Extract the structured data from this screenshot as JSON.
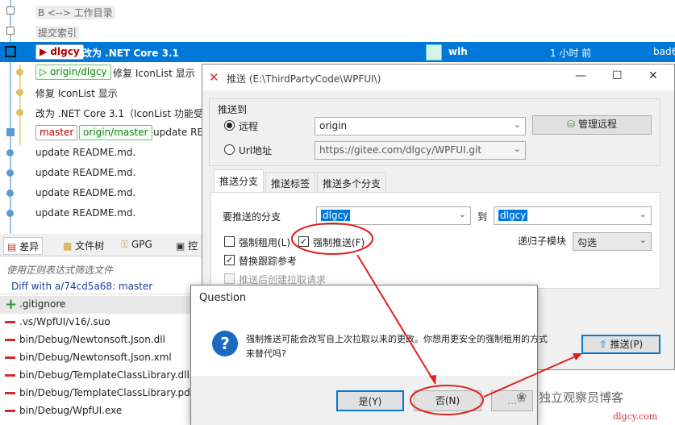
{
  "history": {
    "workdir_row": "B <--> 工作目录",
    "index_row": "提交索引",
    "selected": {
      "branch_tag": "dlgcy",
      "message": "改为 .NET Core 3.1",
      "author": "wlh",
      "time": "1 小时 前",
      "hash": "bad6"
    },
    "rows": [
      {
        "tag": "origin/dlgcy",
        "message": "修复 IconList 显示"
      },
      {
        "message": "修复 IconList 显示"
      },
      {
        "message": "改为 .NET Core 3.1（IconList 功能受"
      },
      {
        "tags": [
          "master",
          "origin/master"
        ],
        "message": "update RE"
      },
      {
        "message": "update README.md."
      },
      {
        "message": "update README.md."
      },
      {
        "message": "update README.md."
      },
      {
        "message": "update README.md."
      }
    ]
  },
  "bottom": {
    "tabs": [
      "差异",
      "文件树",
      "GPG",
      "控"
    ],
    "filter_placeholder": "使用正则表达式筛选文件",
    "diff_header": "Diff with a/74cd5a68: master",
    "files": [
      {
        "kind": "added",
        "path": ".gitignore"
      },
      {
        "kind": "removed",
        "path": ".vs/WpfUI/v16/.suo"
      },
      {
        "kind": "removed",
        "path": "bin/Debug/Newtonsoft.Json.dll"
      },
      {
        "kind": "removed",
        "path": "bin/Debug/Newtonsoft.Json.xml"
      },
      {
        "kind": "removed",
        "path": "bin/Debug/TemplateClassLibrary.dll"
      },
      {
        "kind": "removed",
        "path": "bin/Debug/TemplateClassLibrary.pdb"
      },
      {
        "kind": "removed",
        "path": "bin/Debug/WpfUI.exe"
      }
    ]
  },
  "push_dialog": {
    "title": "推送 (E:\\ThirdPartyCode\\WPFUI\\)",
    "group_label": "推送到",
    "remote_label": "远程",
    "remote_value": "origin",
    "manage_remote": "管理远程",
    "url_label": "Url地址",
    "url_value": "https://gitee.com/dlgcy/WPFUI.git",
    "tabs": [
      "推送分支",
      "推送标签",
      "推送多个分支"
    ],
    "branch_label": "要推送的分支",
    "branch_value": "dlgcy",
    "to_label": "到",
    "to_value": "dlgcy",
    "force_with_lease": "强制租用(L)",
    "force_push": "强制推送(F)",
    "recurse_label": "递归子模块",
    "recurse_value": "勾选",
    "replace_tracking": "替换跟踪参考",
    "create_pr": "推送后创建拉取请求",
    "push_button": "推送(P)"
  },
  "question_dialog": {
    "title": "Question",
    "message_line1": "强制推送可能会改写自上次拉取以来的更改。你想用更安全的强制租用的方式",
    "message_line2": "来替代吗?",
    "yes": "是(Y)",
    "no": "否(N)",
    "cancel": "取消"
  },
  "watermark": {
    "brand": "独立观察员博客",
    "url": "dlgcy.com"
  },
  "colors": {
    "selection": "#0078d7",
    "annotation_red": "#e02020",
    "graph_blue": "#5b9bd5"
  }
}
